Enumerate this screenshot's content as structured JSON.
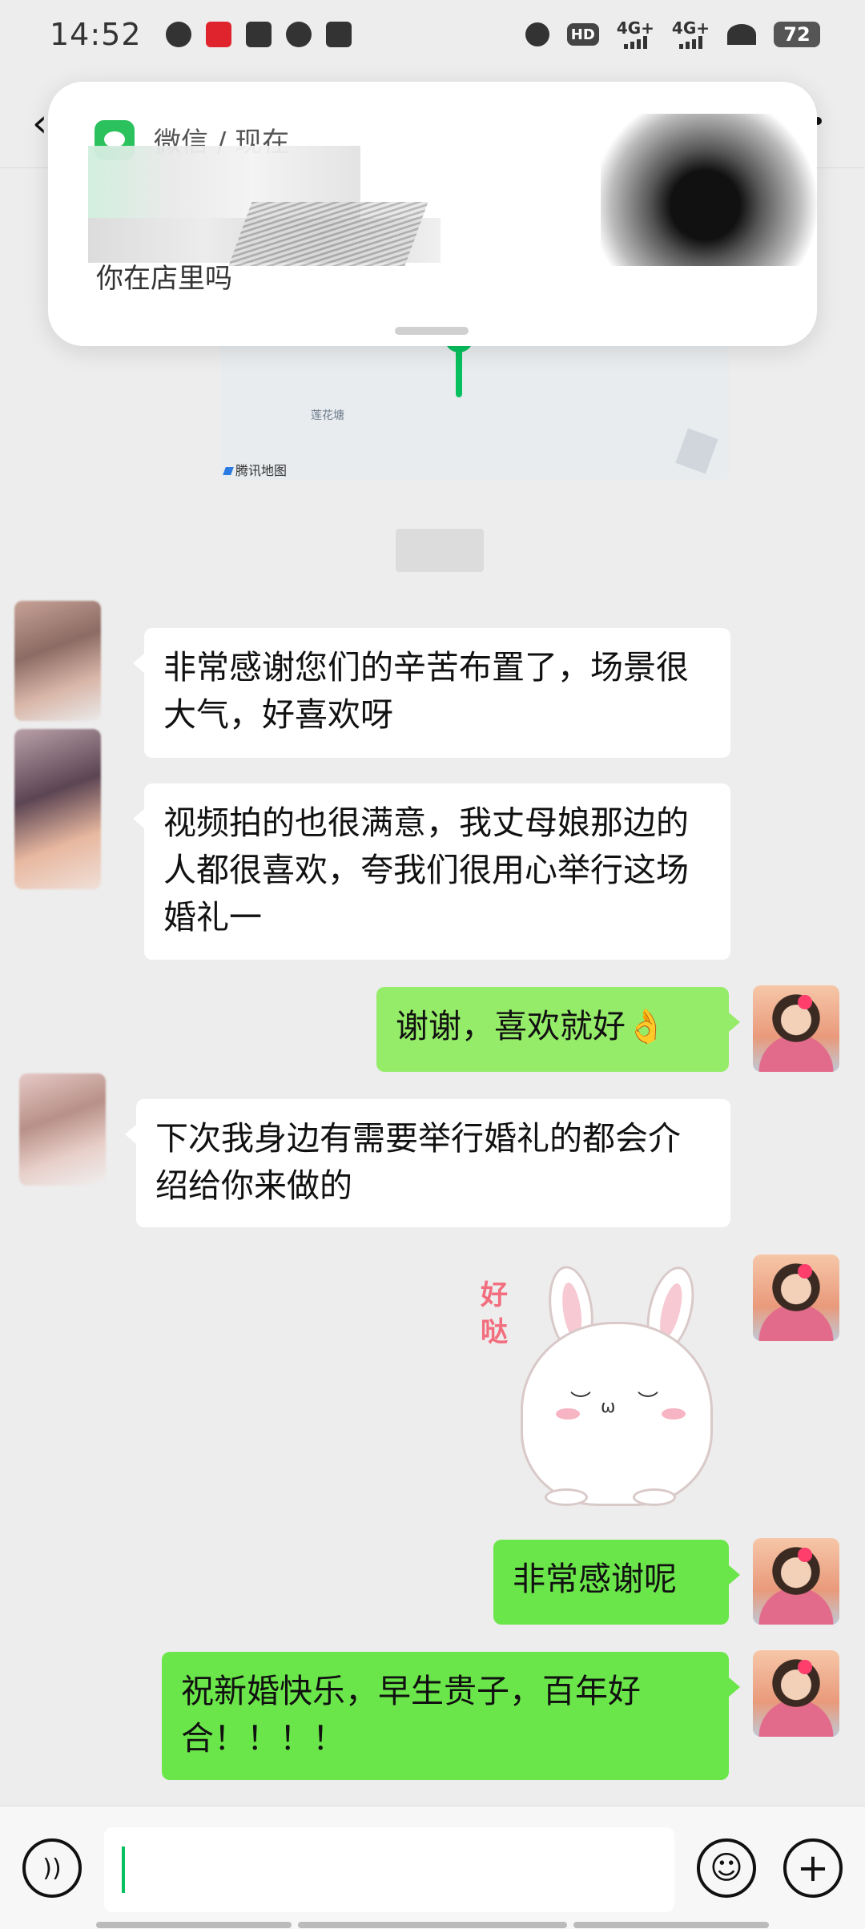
{
  "status_bar": {
    "time": "14:52",
    "net1": "4G+",
    "net2": "4G+",
    "hd": "HD",
    "battery": "72"
  },
  "notification": {
    "app_name": "微信",
    "separator": "/",
    "time": "现在",
    "message": "你在店里吗"
  },
  "map": {
    "place": "莲花塘",
    "source": "腾讯地图"
  },
  "messages": [
    {
      "side": "left",
      "text": "非常感谢您们的辛苦布置了，场景很大气，好喜欢呀"
    },
    {
      "side": "left",
      "text": "视频拍的也很满意，我丈母娘那边的人都很喜欢，夸我们很用心举行这场婚礼一"
    },
    {
      "side": "right",
      "text": "谢谢，喜欢就好👌"
    },
    {
      "side": "left",
      "text": "下次我身边有需要举行婚礼的都会介绍给你来做的"
    },
    {
      "side": "right",
      "type": "sticker",
      "sticker_text": "好哒"
    },
    {
      "side": "right",
      "text": "非常感谢呢"
    },
    {
      "side": "right",
      "text": "祝新婚快乐，早生贵子，百年好合！！！！"
    }
  ],
  "input_bar": {
    "voice_icon": "voice-icon",
    "emoji_icon": "emoji-icon",
    "plus_icon": "plus-icon",
    "input_value": ""
  },
  "colors": {
    "background": "#ededed",
    "bubble_me": "#95ec69",
    "bubble_other": "#ffffff",
    "wechat_green": "#07c160"
  }
}
